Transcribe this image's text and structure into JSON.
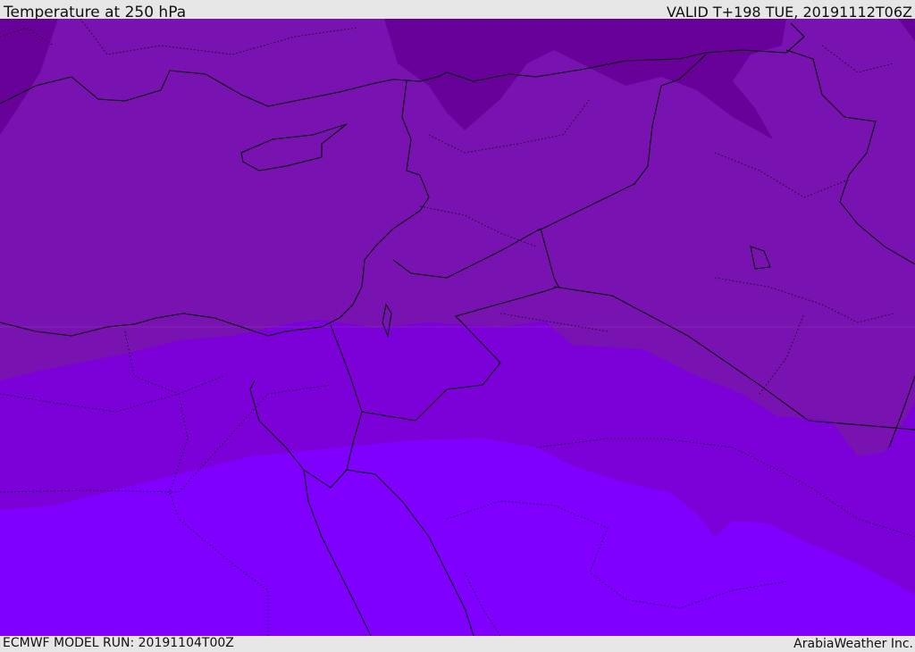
{
  "header": {
    "title": "Temperature at 250 hPa",
    "valid": "VALID T+198 TUE, 20191112T06Z"
  },
  "footer": {
    "model_run": "ECMWF MODEL RUN: 20191104T00Z",
    "credit": "ArabiaWeather Inc."
  },
  "colors": {
    "band_coldest": "#68009a",
    "band_cold": "#7812b0",
    "band_mid": "#7c00d8",
    "band_warm": "#7f00ff",
    "coastline": "#000000"
  }
}
